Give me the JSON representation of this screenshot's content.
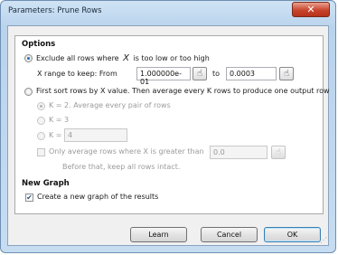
{
  "window": {
    "title": "Parameters: Prune Rows",
    "close_glyph": "✕"
  },
  "options": {
    "heading": "Options",
    "exclude_radio": {
      "label_pre": "Exclude all rows where",
      "symbol": "X",
      "label_post": "is too low or too high",
      "checked": true
    },
    "x_range": {
      "label_pre": "X range to keep:  From",
      "from_value": "1.000000e-01",
      "to_label": "to",
      "to_value": "0.0003",
      "pick_icon": "finger-pointer-icon"
    },
    "sort_radio": {
      "label": "First sort rows by X value. Then average every K rows to produce one output row",
      "checked": false
    },
    "k2_label": "K = 2. Average every pair of rows",
    "k3_label": "K = 3",
    "kcustom_label": "K =",
    "kcustom_value": "4",
    "only_average": {
      "label": "Only average rows where X is greater than",
      "value": "0.0",
      "checked": false
    },
    "before_note": "Before that, keep all rows intact."
  },
  "new_graph": {
    "heading": "New Graph",
    "create_label": "Create a new graph of the results",
    "checked": true
  },
  "buttons": {
    "learn": "Learn",
    "cancel": "Cancel",
    "ok": "OK"
  }
}
